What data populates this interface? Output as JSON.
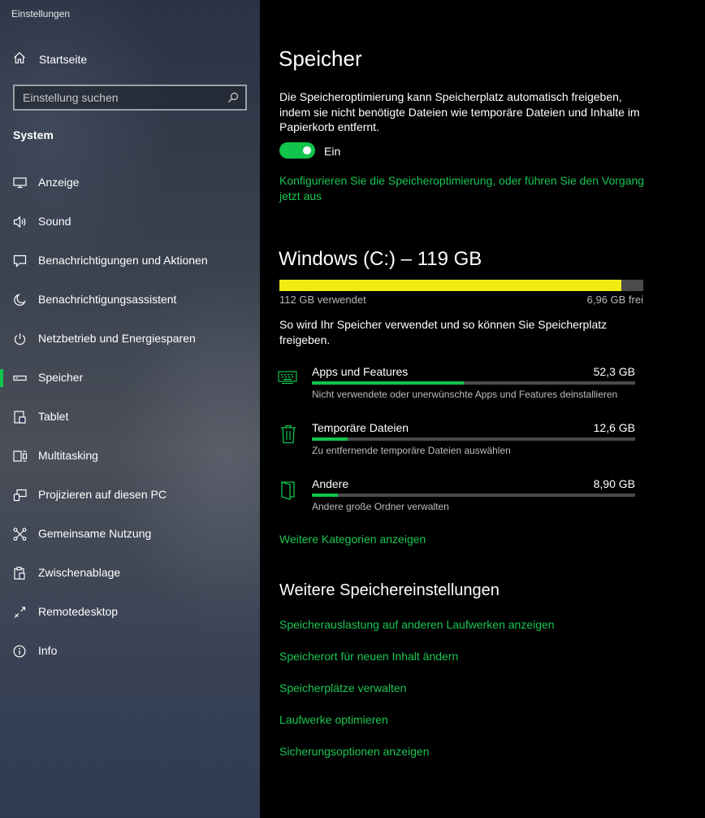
{
  "window": {
    "title": "Einstellungen"
  },
  "sidebar": {
    "home_label": "Startseite",
    "search_placeholder": "Einstellung suchen",
    "section_title": "System",
    "items": [
      {
        "label": "Anzeige",
        "icon": "monitor-icon",
        "active": false
      },
      {
        "label": "Sound",
        "icon": "speaker-icon",
        "active": false
      },
      {
        "label": "Benachrichtigungen und Aktionen",
        "icon": "notification-icon",
        "active": false
      },
      {
        "label": "Benachrichtigungsassistent",
        "icon": "moon-icon",
        "active": false
      },
      {
        "label": "Netzbetrieb und Energiesparen",
        "icon": "power-icon",
        "active": false
      },
      {
        "label": "Speicher",
        "icon": "storage-icon",
        "active": true
      },
      {
        "label": "Tablet",
        "icon": "tablet-icon",
        "active": false
      },
      {
        "label": "Multitasking",
        "icon": "multitasking-icon",
        "active": false
      },
      {
        "label": "Projizieren auf diesen PC",
        "icon": "project-icon",
        "active": false
      },
      {
        "label": "Gemeinsame Nutzung",
        "icon": "share-icon",
        "active": false
      },
      {
        "label": "Zwischenablage",
        "icon": "clipboard-icon",
        "active": false
      },
      {
        "label": "Remotedesktop",
        "icon": "remote-desktop-icon",
        "active": false
      },
      {
        "label": "Info",
        "icon": "info-icon",
        "active": false
      }
    ]
  },
  "main": {
    "title": "Speicher",
    "description": "Die Speicheroptimierung kann Speicherplatz automatisch freigeben, indem sie nicht benötigte Dateien wie temporäre Dateien und Inhalte im Papierkorb entfernt.",
    "toggle": {
      "state": "Ein",
      "on": true
    },
    "configure_link": "Konfigurieren Sie die Speicheroptimierung, oder führen Sie den Vorgang jetzt aus",
    "drive": {
      "title": "Windows (C:) – 119 GB",
      "used_label": "112 GB verwendet",
      "free_label": "6,96 GB frei",
      "used_fraction": 0.94
    },
    "usage_intro": "So wird Ihr Speicher verwendet und so können Sie Speicherplatz freigeben.",
    "categories": [
      {
        "name": "Apps und Features",
        "size": "52,3 GB",
        "description": "Nicht verwendete oder unerwünschte Apps und Features deinstallieren",
        "fraction": 0.47,
        "icon": "apps-keyboard-icon"
      },
      {
        "name": "Temporäre Dateien",
        "size": "12,6 GB",
        "description": "Zu entfernende temporäre Dateien auswählen",
        "fraction": 0.11,
        "icon": "trash-icon"
      },
      {
        "name": "Andere",
        "size": "8,90 GB",
        "description": "Andere große Ordner verwalten",
        "fraction": 0.08,
        "icon": "folder-icon"
      }
    ],
    "more_categories_link": "Weitere Kategorien anzeigen",
    "more_settings": {
      "title": "Weitere Speichereinstellungen",
      "links": [
        "Speicherauslastung auf anderen Laufwerken anzeigen",
        "Speicherort für neuen Inhalt ändern",
        "Speicherplätze verwalten",
        "Laufwerke optimieren",
        "Sicherungsoptionen anzeigen"
      ]
    }
  },
  "colors": {
    "accent": "#10c44c",
    "link": "#19c653",
    "drive_fill": "#f2eb12",
    "bar_track": "#4b4b4b"
  }
}
